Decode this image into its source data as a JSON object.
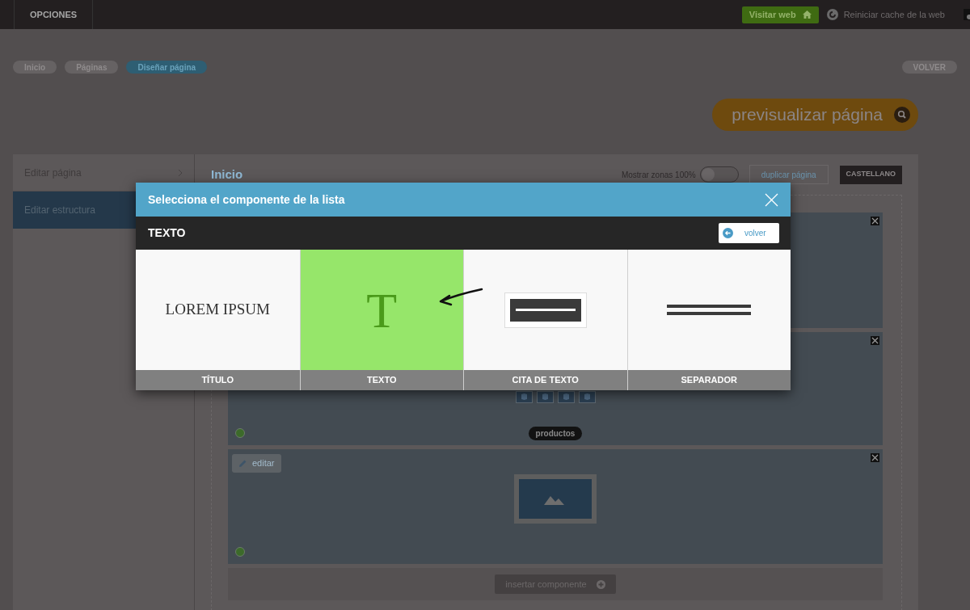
{
  "top_bar": {
    "menu": "OPCIONES",
    "visit_button": "Visitar web",
    "cache_link": "Reiniciar cache de la web"
  },
  "breadcrumbs": [
    {
      "label": "Inicio",
      "selected": false
    },
    {
      "label": "Páginas",
      "selected": false
    },
    {
      "label": "Diseñar página",
      "selected": true
    }
  ],
  "back_button": "VOLVER",
  "preview_button": "previsualizar página",
  "sidebar": {
    "items": [
      {
        "label": "Editar página",
        "selected": false
      },
      {
        "label": "Editar estructura",
        "selected": true
      }
    ]
  },
  "page": {
    "title": "Inicio",
    "toggle": {
      "label": "Mostrar zonas 100%",
      "on": false
    },
    "duplicate_button": "duplicar página",
    "language_button": "CASTELLANO",
    "zones": [
      {
        "kind": "blank"
      },
      {
        "kind": "products",
        "badge": "productos"
      },
      {
        "kind": "image",
        "edit_button": "editar"
      }
    ],
    "insert_button": "insertar componente"
  },
  "modal": {
    "title": "Selecciona el componente de la lista",
    "category": "TEXTO",
    "back_button": "volver",
    "components": [
      {
        "kind": "title",
        "sample": "LOREM IPSUM",
        "label": "TÍTULO",
        "selected": false
      },
      {
        "kind": "text",
        "sample": "T",
        "label": "TEXTO",
        "selected": true
      },
      {
        "kind": "quote",
        "label": "CITA DE TEXTO",
        "selected": false
      },
      {
        "kind": "separator",
        "label": "SEPARADOR",
        "selected": false
      }
    ]
  }
}
